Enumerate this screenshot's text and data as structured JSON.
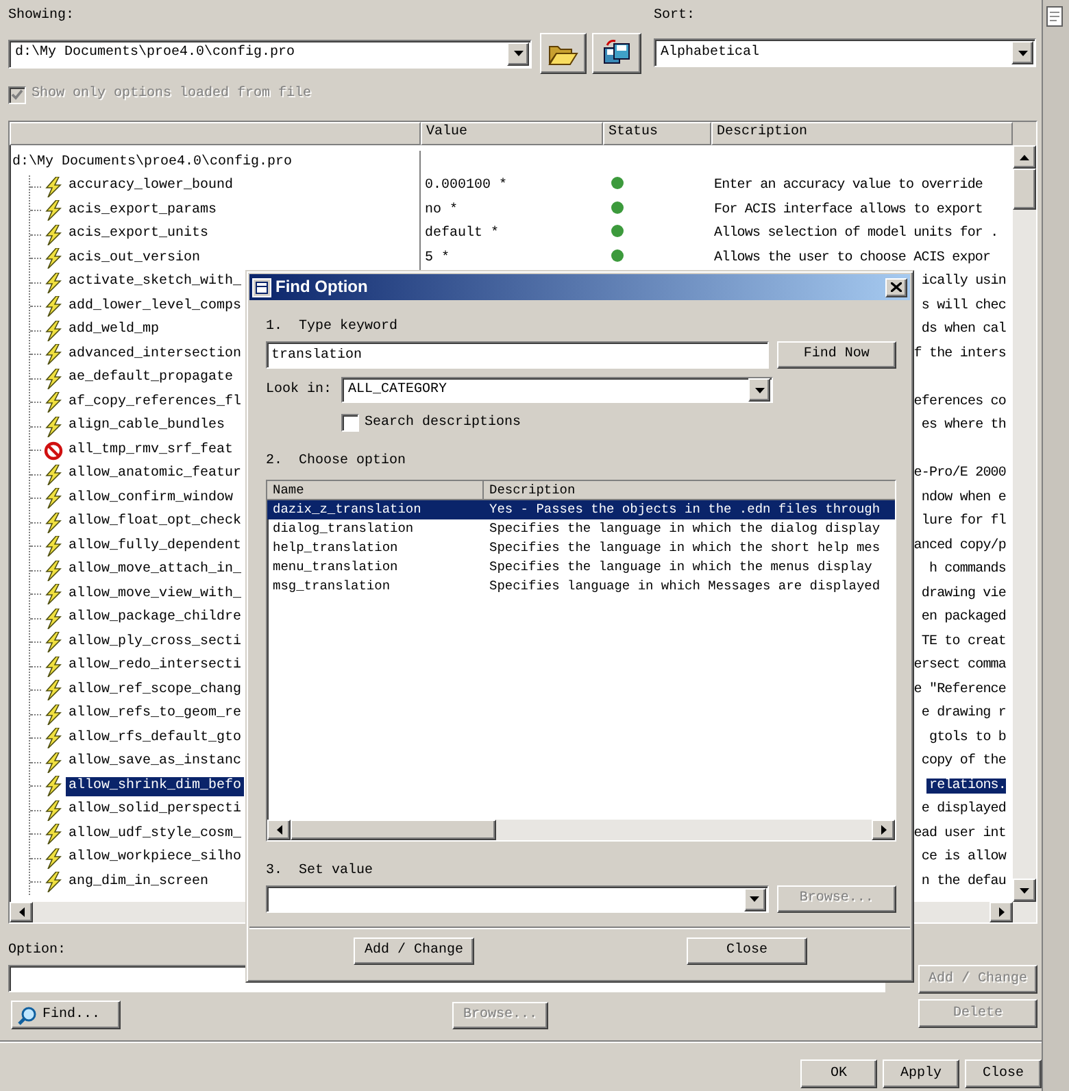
{
  "showing": {
    "label": "Showing:",
    "value": "d:\\My Documents\\proe4.0\\config.pro"
  },
  "sort": {
    "label": "Sort:",
    "value": "Alphabetical"
  },
  "show_loaded_only": {
    "label": "Show only options loaded from file",
    "checked": true,
    "disabled": true
  },
  "table": {
    "columns": [
      "Value",
      "Status",
      "Description"
    ],
    "root": "d:\\My Documents\\proe4.0\\config.pro",
    "rows": [
      {
        "name": "accuracy_lower_bound",
        "kind": "lightning",
        "selected": false,
        "value": "0.000100 *",
        "status_dot": true,
        "description": "Enter an accuracy value to override"
      },
      {
        "name": "acis_export_params",
        "kind": "lightning",
        "selected": false,
        "value": "no *",
        "status_dot": true,
        "description": "For ACIS interface allows to export"
      },
      {
        "name": "acis_export_units",
        "kind": "lightning",
        "selected": false,
        "value": "default *",
        "status_dot": true,
        "description": "Allows selection of model units for ."
      },
      {
        "name": "acis_out_version",
        "kind": "lightning",
        "selected": false,
        "value": "5 *",
        "status_dot": true,
        "description": "Allows the user to choose ACIS expor"
      },
      {
        "name": "activate_sketch_with_",
        "kind": "lightning",
        "selected": false,
        "description": "ically usin"
      },
      {
        "name": "add_lower_level_comps",
        "kind": "lightning",
        "selected": false,
        "description": "s will chec"
      },
      {
        "name": "add_weld_mp",
        "kind": "lightning",
        "selected": false,
        "description": "ds when cal"
      },
      {
        "name": "advanced_intersection",
        "kind": "lightning",
        "selected": false,
        "description": "f the inters"
      },
      {
        "name": "ae_default_propagate",
        "kind": "lightning",
        "selected": false
      },
      {
        "name": "af_copy_references_fl",
        "kind": "lightning",
        "selected": false,
        "description": "eferences co"
      },
      {
        "name": "align_cable_bundles",
        "kind": "lightning",
        "selected": false,
        "description": "es where th"
      },
      {
        "name": "all_tmp_rmv_srf_feat",
        "kind": "prohibited",
        "selected": false
      },
      {
        "name": "allow_anatomic_featur",
        "kind": "lightning",
        "selected": false,
        "description": "e-Pro/E 2000"
      },
      {
        "name": "allow_confirm_window",
        "kind": "lightning",
        "selected": false,
        "description": "ndow when e"
      },
      {
        "name": "allow_float_opt_check",
        "kind": "lightning",
        "selected": false,
        "description": "lure for fl"
      },
      {
        "name": "allow_fully_dependent",
        "kind": "lightning",
        "selected": false,
        "description": "anced copy/p"
      },
      {
        "name": "allow_move_attach_in_",
        "kind": "lightning",
        "selected": false,
        "description": "h commands"
      },
      {
        "name": "allow_move_view_with_",
        "kind": "lightning",
        "selected": false,
        "description": "drawing vie"
      },
      {
        "name": "allow_package_childre",
        "kind": "lightning",
        "selected": false,
        "description": "en packaged"
      },
      {
        "name": "allow_ply_cross_secti",
        "kind": "lightning",
        "selected": false,
        "description": "TE to creat"
      },
      {
        "name": "allow_redo_intersecti",
        "kind": "lightning",
        "selected": false,
        "description": "ersect comma"
      },
      {
        "name": "allow_ref_scope_chang",
        "kind": "lightning",
        "selected": false,
        "description": "e \"Reference"
      },
      {
        "name": "allow_refs_to_geom_re",
        "kind": "lightning",
        "selected": false,
        "description": "e drawing r"
      },
      {
        "name": "allow_rfs_default_gto",
        "kind": "lightning",
        "selected": false,
        "description": "gtols to b"
      },
      {
        "name": "allow_save_as_instanc",
        "kind": "lightning",
        "selected": false,
        "description": "copy of the"
      },
      {
        "name": "allow_shrink_dim_befo",
        "kind": "lightning",
        "selected": true,
        "description": "relations."
      },
      {
        "name": "allow_solid_perspecti",
        "kind": "lightning",
        "selected": false,
        "description": "e displayed"
      },
      {
        "name": "allow_udf_style_cosm_",
        "kind": "lightning",
        "selected": false,
        "description": "ead user int"
      },
      {
        "name": "allow_workpiece_silho",
        "kind": "lightning",
        "selected": false,
        "description": "ce is allow"
      },
      {
        "name": "ang_dim_in_screen",
        "kind": "lightning",
        "selected": false,
        "description": "n the defau"
      }
    ]
  },
  "option": {
    "label": "Option:"
  },
  "find_button": "Find...",
  "browse_button": {
    "label": "Browse...",
    "disabled": true
  },
  "add_change_button": {
    "label": "Add / Change",
    "disabled": true
  },
  "delete_button": {
    "label": "Delete",
    "disabled": true
  },
  "footer_buttons": [
    {
      "label": "OK"
    },
    {
      "label": "Apply"
    },
    {
      "label": "Close"
    }
  ],
  "find_dialog": {
    "title": "Find Option",
    "step1": "1.  Type keyword",
    "keyword": "translation",
    "find_now": "Find Now",
    "look_in_label": "Look in:",
    "look_in": "ALL_CATEGORY",
    "search_descriptions": {
      "label": "Search descriptions",
      "checked": false
    },
    "step2": "2.  Choose option",
    "columns": [
      "Name",
      "Description"
    ],
    "options": [
      {
        "name": "dazix_z_translation",
        "description": "Yes - Passes the objects in the .edn files through",
        "selected": true
      },
      {
        "name": "dialog_translation",
        "description": "Specifies the language in which the dialog display",
        "selected": false
      },
      {
        "name": "help_translation",
        "description": "Specifies the language in which the short help mes",
        "selected": false
      },
      {
        "name": "menu_translation",
        "description": "Specifies the language in which the menus display",
        "selected": false
      },
      {
        "name": "msg_translation",
        "description": "Specifies language in which Messages are displayed",
        "selected": false
      }
    ],
    "step3": "3.  Set value",
    "browse_button": {
      "label": "Browse...",
      "disabled": true
    },
    "buttons": [
      {
        "label": "Add / Change"
      },
      {
        "label": "Close"
      }
    ]
  }
}
